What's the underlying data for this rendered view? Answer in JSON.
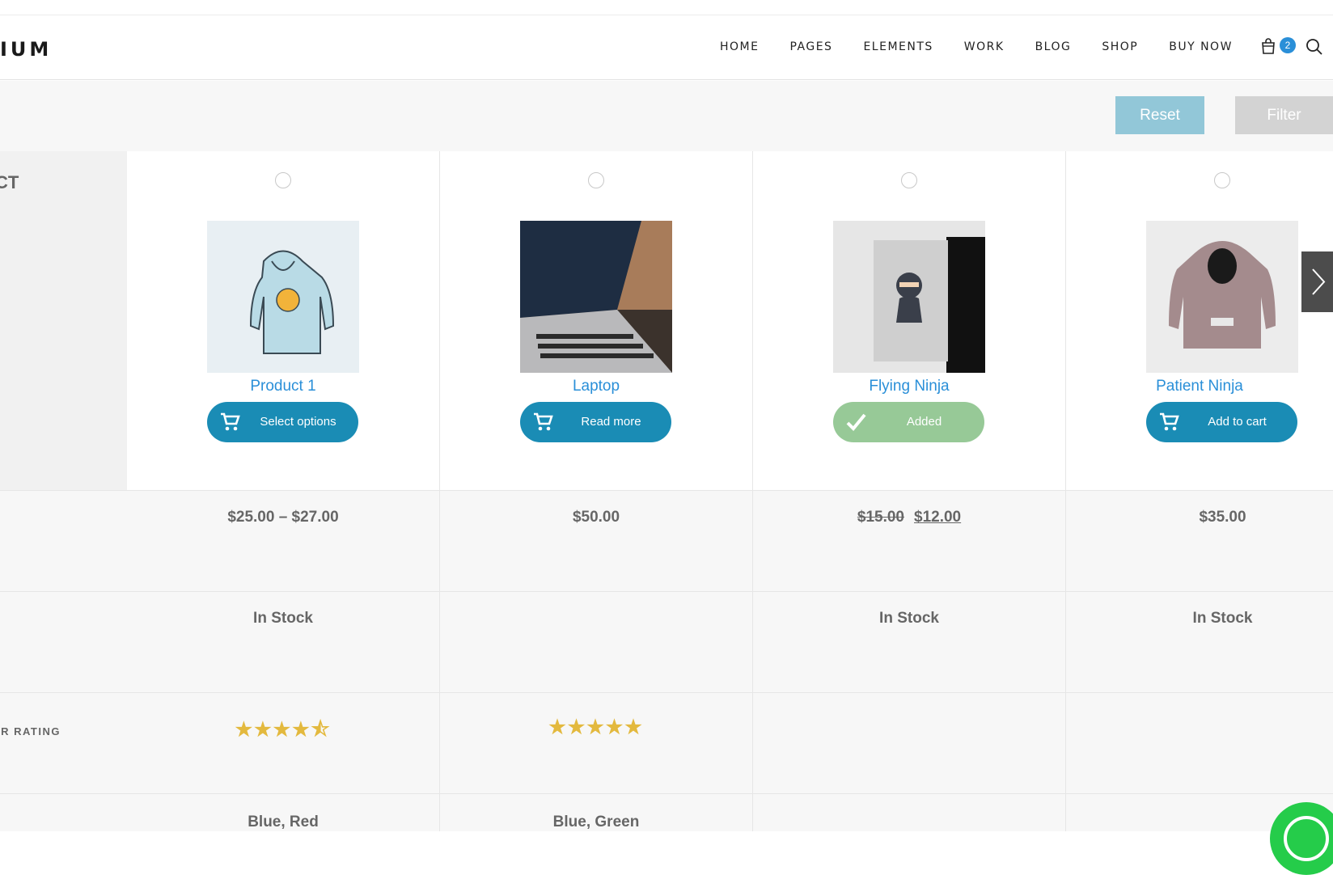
{
  "header": {
    "logo_text": "IUM",
    "nav": [
      "HOME",
      "PAGES",
      "ELEMENTS",
      "WORK",
      "BLOG",
      "SHOP",
      "BUY NOW"
    ],
    "cart_count": "2"
  },
  "filterbar": {
    "reset_label": "Reset",
    "filter_label": "Filter"
  },
  "labels": {
    "product": "CT",
    "price": "",
    "availability": "",
    "rating": "R RATING",
    "color": ""
  },
  "products": [
    {
      "name": "Product 1",
      "button": "Select options",
      "price": "$25.00 – $27.00",
      "stock": "In Stock",
      "rating": 4.5,
      "color": "Blue, Red"
    },
    {
      "name": "Laptop",
      "button": "Read more",
      "price": "$50.00",
      "stock": "",
      "rating": 5,
      "color": "Blue, Green"
    },
    {
      "name": "Flying Ninja",
      "button": "Added",
      "price_old": "$15.00",
      "price": "$12.00",
      "stock": "In Stock",
      "rating": 0,
      "color": ""
    },
    {
      "name": "Patient Ninja",
      "button": "Add to cart",
      "price": "$35.00",
      "stock": "In Stock",
      "rating": 0,
      "color": ""
    }
  ],
  "colors": {
    "accent": "#2a8fd8",
    "button": "#1a8cb5",
    "added": "#97c997",
    "star": "#e3b93e"
  }
}
